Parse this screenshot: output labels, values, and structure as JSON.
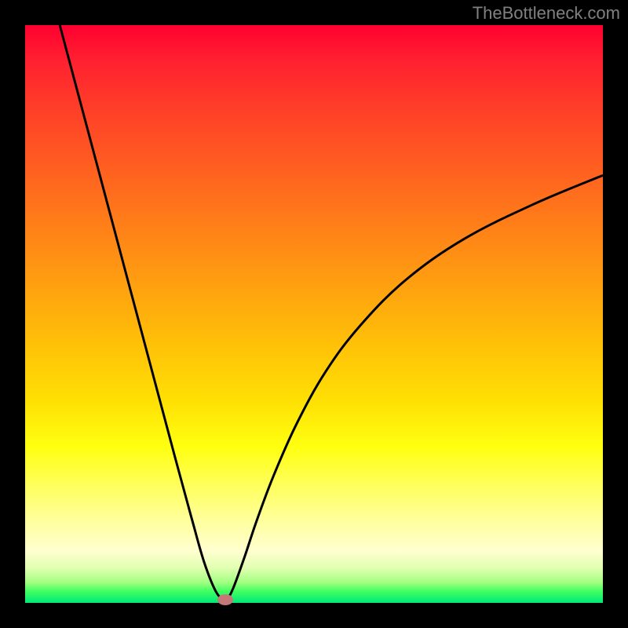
{
  "attribution": "TheBottleneck.com",
  "chart_data": {
    "type": "line",
    "title": "",
    "xlabel": "",
    "ylabel": "",
    "xlim": [
      0,
      100
    ],
    "ylim": [
      0,
      100
    ],
    "left_branch": {
      "comment": "Descending curve from upper-left to minimum near x≈34.7",
      "x": [
        6,
        10,
        14,
        18,
        22,
        26,
        29,
        31,
        33,
        34.7
      ],
      "y": [
        100,
        85,
        70,
        55,
        40,
        25,
        14,
        7,
        2,
        0
      ]
    },
    "right_branch": {
      "comment": "Ascending curve from minimum rising toward upper-right with decreasing slope",
      "x": [
        34.7,
        36,
        38,
        40,
        43,
        47,
        52,
        58,
        66,
        76,
        88,
        100
      ],
      "y": [
        0,
        2.5,
        8,
        14,
        22,
        31,
        40,
        48,
        56,
        63,
        69,
        74
      ]
    },
    "minimum_marker": {
      "x": 34.7,
      "y": 0,
      "color": "#c67878"
    },
    "background_gradient": {
      "top": "#ff0030",
      "middle": "#ffe000",
      "bottom": "#00e878"
    }
  }
}
